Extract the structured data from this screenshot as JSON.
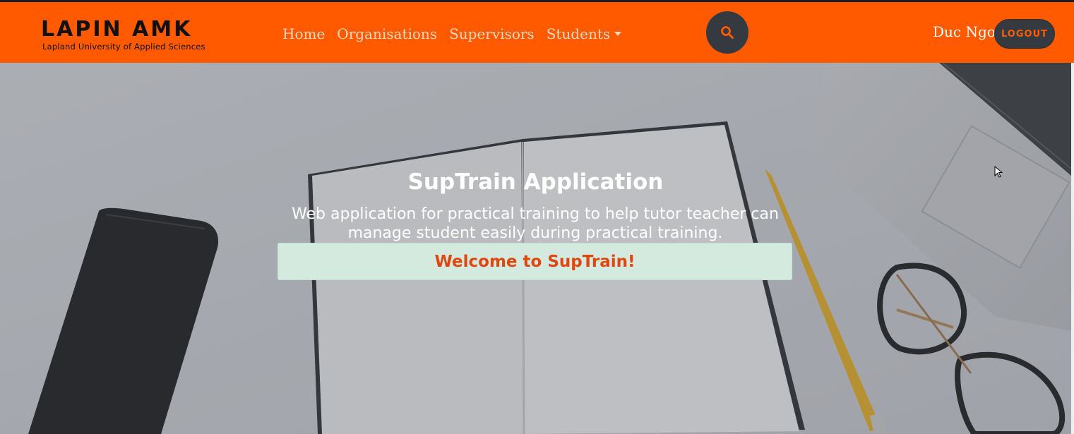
{
  "header": {
    "logo_title": "LAPIN AMK",
    "logo_subtitle": "Lapland University of Applied Sciences",
    "nav": [
      {
        "label": "Home"
      },
      {
        "label": "Organisations"
      },
      {
        "label": "Supervisors"
      },
      {
        "label": "Students",
        "has_dropdown": true
      }
    ],
    "search_icon": "search-icon",
    "user_name": "Duc Ngo",
    "logout_label": "LOGOUT"
  },
  "hero": {
    "title": "SupTrain Application",
    "description": "Web application for practical training to help tutor teacher can manage student easily during practical training.",
    "welcome_message": "Welcome to SupTrain!"
  },
  "colors": {
    "navbar": "#ff5a00",
    "nav_link": "#ffd9bf",
    "dark_button": "#343a40",
    "welcome_bg": "#d4eadf",
    "welcome_text": "#e0470e"
  }
}
